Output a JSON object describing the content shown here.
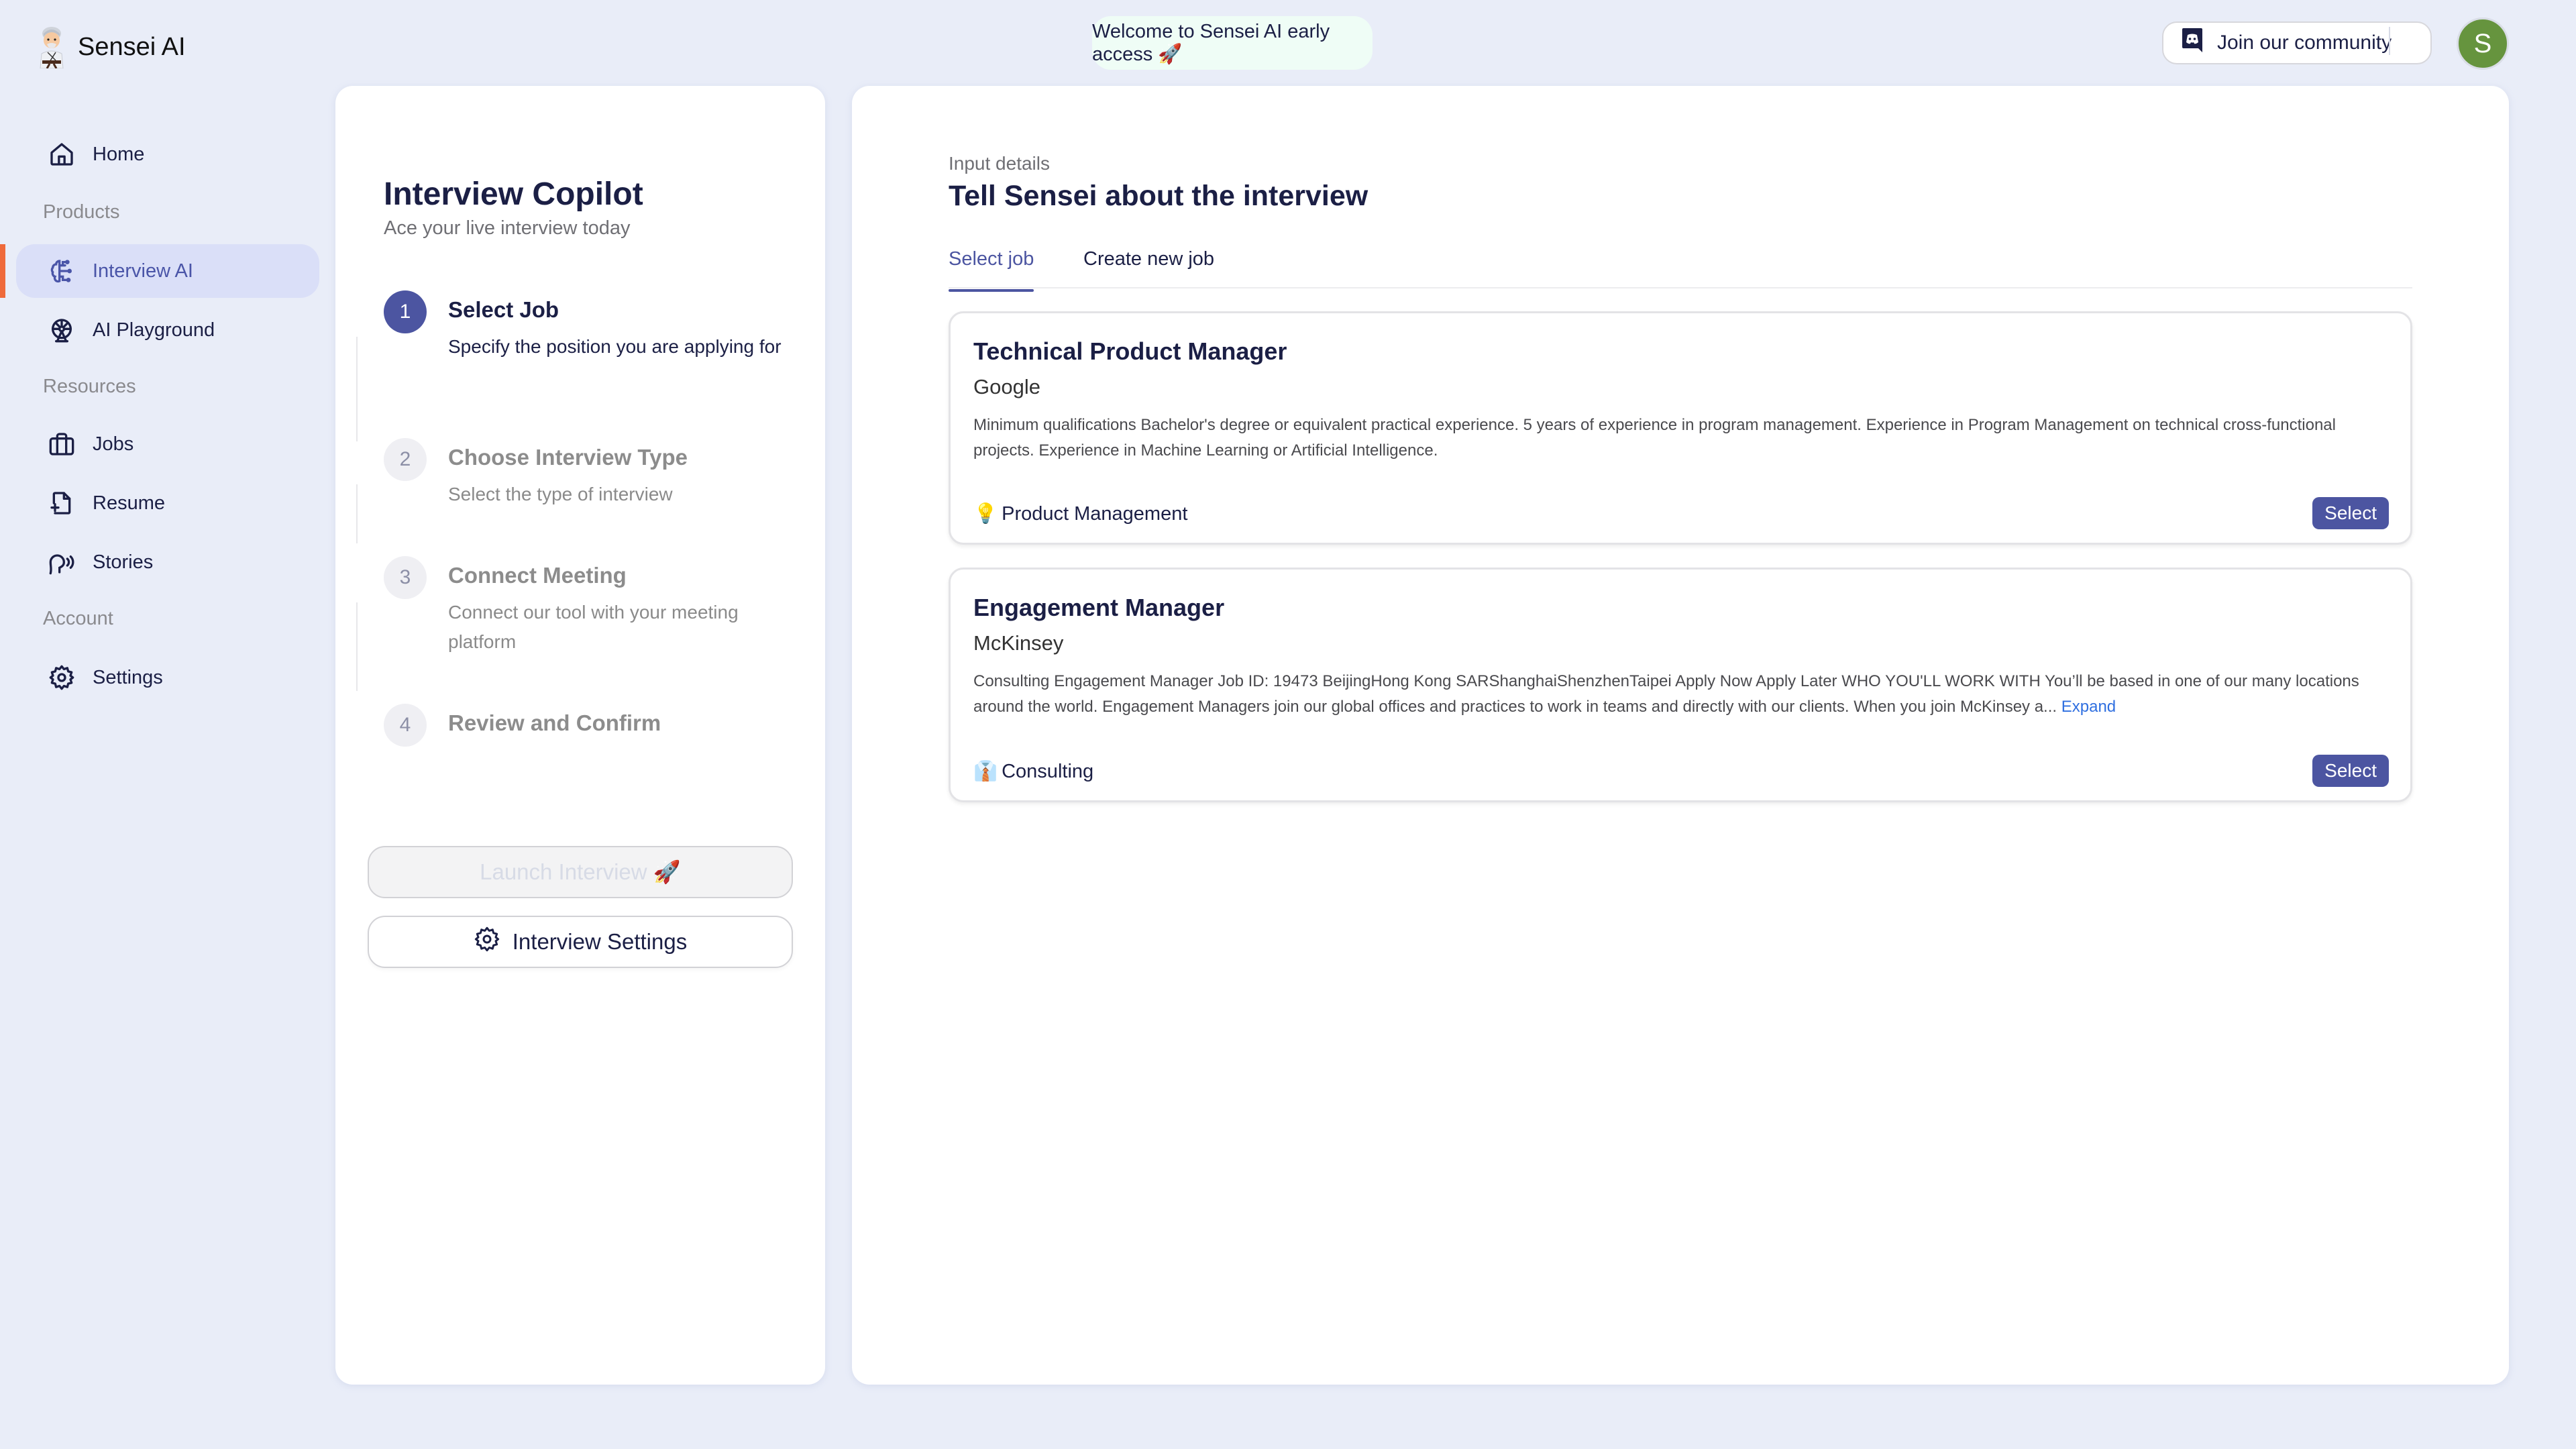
{
  "app": {
    "name": "Sensei AI",
    "welcome_banner": "Welcome to Sensei AI early access 🚀",
    "community_button": "Join our community",
    "avatar_initial": "S",
    "colors": {
      "accent": "#4c55a1",
      "active_indicator": "#ef6a3b",
      "avatar": "#66943e",
      "background": "#e9edf8"
    }
  },
  "sidebar": {
    "items": [
      {
        "type": "link",
        "label": "Home",
        "icon": "home-icon"
      },
      {
        "type": "section",
        "label": "Products"
      },
      {
        "type": "link",
        "label": "Interview AI",
        "icon": "brain-circuit-icon",
        "active": true
      },
      {
        "type": "link",
        "label": "AI Playground",
        "icon": "ferris-wheel-icon"
      },
      {
        "type": "section",
        "label": "Resources"
      },
      {
        "type": "link",
        "label": "Jobs",
        "icon": "briefcase-icon"
      },
      {
        "type": "link",
        "label": "Resume",
        "icon": "file-plus-icon"
      },
      {
        "type": "link",
        "label": "Stories",
        "icon": "speaking-head-icon"
      },
      {
        "type": "section",
        "label": "Account"
      },
      {
        "type": "link",
        "label": "Settings",
        "icon": "gear-icon"
      }
    ]
  },
  "copilot": {
    "title": "Interview Copilot",
    "subtitle": "Ace your live interview today",
    "steps": [
      {
        "number": "1",
        "title": "Select Job",
        "description": "Specify the position you are applying for",
        "state": "current"
      },
      {
        "number": "2",
        "title": "Choose Interview Type",
        "description": "Select the type of interview",
        "state": "pending"
      },
      {
        "number": "3",
        "title": "Connect Meeting",
        "description": "Connect our tool with your meeting platform",
        "state": "pending"
      },
      {
        "number": "4",
        "title": "Review and Confirm",
        "description": "",
        "state": "pending"
      }
    ],
    "launch_button": "Launch Interview 🚀",
    "launch_disabled": true,
    "settings_button": "Interview Settings"
  },
  "details": {
    "kicker": "Input details",
    "title": "Tell Sensei about the interview",
    "tabs": [
      {
        "label": "Select job",
        "active": true
      },
      {
        "label": "Create new job",
        "active": false
      }
    ],
    "jobs": [
      {
        "title": "Technical Product Manager",
        "company": "Google",
        "description": "Minimum qualifications Bachelor's degree or equivalent practical experience. 5 years of experience in program management. Experience in Program Management on technical cross-functional projects. Experience in Machine Learning or Artificial Intelligence.",
        "expand_label": "",
        "category_emoji": "💡",
        "category": "Product Management",
        "select_label": "Select"
      },
      {
        "title": "Engagement Manager",
        "company": "McKinsey",
        "description": "Consulting Engagement Manager Job ID: 19473 BeijingHong Kong SARShanghaiShenzhenTaipei Apply Now Apply Later WHO YOU'LL WORK WITH You’ll be based in one of our many locations around the world. Engagement Managers join our global offices and practices to work in teams and directly with our clients. When you join McKinsey a...",
        "expand_label": "Expand",
        "category_emoji": "👔",
        "category": "Consulting",
        "select_label": "Select"
      }
    ]
  }
}
